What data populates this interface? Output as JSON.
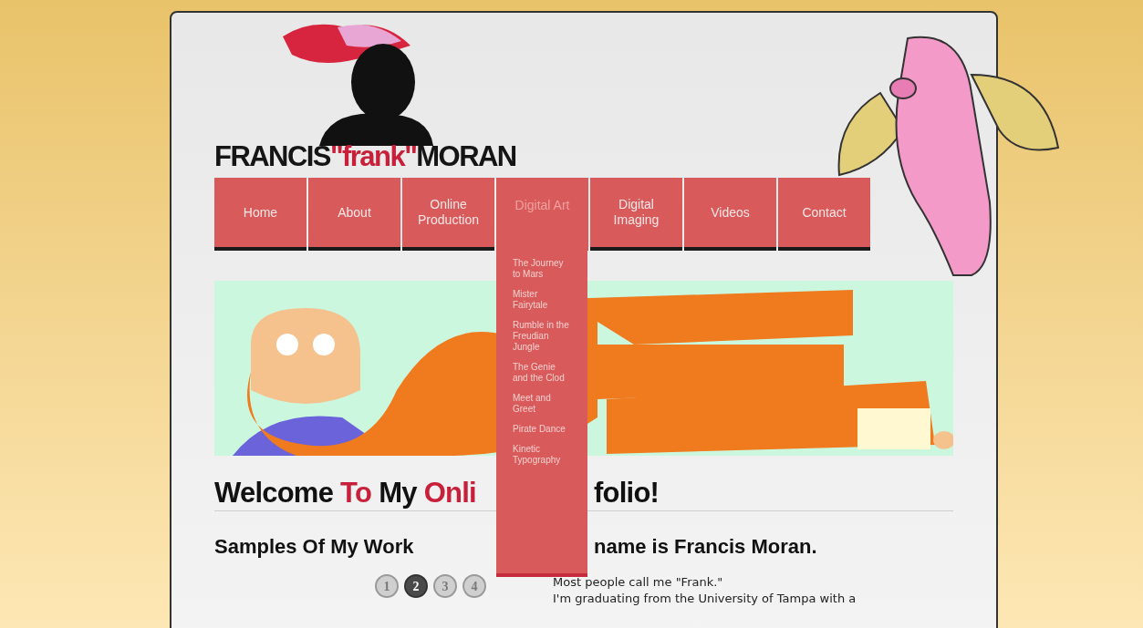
{
  "logo": {
    "first": "FRANCIS",
    "nick": "\"frank\"",
    "last": "MORAN"
  },
  "nav": [
    {
      "label": "Home",
      "selected": false
    },
    {
      "label": "About",
      "selected": false
    },
    {
      "label": "Online Production",
      "selected": false
    },
    {
      "label": "Digital Art",
      "selected": true,
      "submenu": [
        "The Journey to Mars",
        "Mister Fairytale",
        "Rumble in the Freudian Jungle",
        "The Genie and the Clod",
        "Meet and Greet",
        "Pirate Dance",
        "Kinetic Typography"
      ]
    },
    {
      "label": "Digital Imaging",
      "selected": false
    },
    {
      "label": "Videos",
      "selected": false
    },
    {
      "label": "Contact",
      "selected": false
    }
  ],
  "heading": {
    "parts": [
      {
        "text": "Welcome",
        "accent": false
      },
      {
        "text": "To",
        "accent": true
      },
      {
        "text": "My",
        "accent": false
      },
      {
        "text": "Onli",
        "accent": true
      }
    ],
    "after_menu": "folio!"
  },
  "samples": {
    "title": "Samples Of My Work",
    "pages": [
      {
        "label": "1",
        "selected": false
      },
      {
        "label": "2",
        "selected": true
      },
      {
        "label": "3",
        "selected": false
      },
      {
        "label": "4",
        "selected": false
      }
    ]
  },
  "about": {
    "title": "name is Francis Moran.",
    "lines": [
      "Most people call me \"Frank.\"",
      "I'm graduating from the University of Tampa with a"
    ]
  }
}
